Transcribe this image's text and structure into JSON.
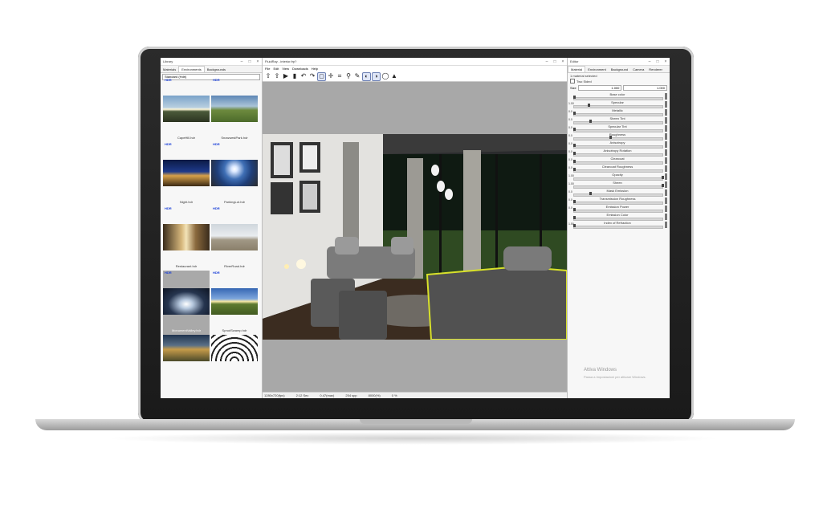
{
  "library": {
    "title": "Library",
    "tabs": [
      "Materials",
      "Environments",
      "Backgrounds"
    ],
    "filter": "Standard (Hdri)",
    "items": [
      {
        "tag": "HDR",
        "name": "CapeHill.hdr"
      },
      {
        "tag": "HDR",
        "name": "SnowwestPark.hdr"
      },
      {
        "tag": "HDR",
        "name": "Night.hdr"
      },
      {
        "tag": "HDR",
        "name": "ParkingLot.hdr"
      },
      {
        "tag": "HDR",
        "name": "Restaurant.hdr"
      },
      {
        "tag": "HDR",
        "name": "RiverRoad.hdr"
      },
      {
        "tag": "HDR",
        "name": "MonumentValley.hdr"
      },
      {
        "tag": "HDR",
        "name": "SprudSwamp.hdr"
      },
      {
        "tag": "",
        "name": ""
      },
      {
        "tag": "",
        "name": ""
      }
    ]
  },
  "viewport": {
    "title": "FluidRay - interior.frp?",
    "menu": [
      "File",
      "Edit",
      "View",
      "Downloads",
      "Help"
    ],
    "status": [
      "1280x720(fps)",
      "2:12 Sec",
      "0.47(max)",
      "254 spp",
      "8000(%)",
      "0 %"
    ]
  },
  "editor": {
    "title": "Editor",
    "tabs": [
      "Material",
      "Environment",
      "Background",
      "Camera",
      "Renderer"
    ],
    "selected": "1 material selected",
    "two_sided": "Two Sided",
    "size_label": "Size",
    "size_x": "1.000",
    "size_y": "1.000",
    "sliders": [
      {
        "label": "Base color",
        "value": ""
      },
      {
        "label": "Specular",
        "value": "1.00"
      },
      {
        "label": "Metallic",
        "value": "0.0"
      },
      {
        "label": "Sheen Tint",
        "value": "0.0"
      },
      {
        "label": "Specular Tint",
        "value": "0.0"
      },
      {
        "label": "Roughness",
        "value": "0.0"
      },
      {
        "label": "Anisotropy",
        "value": "0.0"
      },
      {
        "label": "Anisotropy Rotation",
        "value": "0.0"
      },
      {
        "label": "Clearcoat",
        "value": "0.0"
      },
      {
        "label": "Clearcoat Roughness",
        "value": "0.0"
      },
      {
        "label": "Opacity",
        "value": "1.00"
      },
      {
        "label": "Sheen",
        "value": "1.00"
      },
      {
        "label": "Mask Emission",
        "value": "0.0"
      },
      {
        "label": "Transmission Roughness",
        "value": "0.0"
      },
      {
        "label": "Emission Power",
        "value": "0.0"
      },
      {
        "label": "Emission Color",
        "value": ""
      },
      {
        "label": "Index of Refraction",
        "value": "1.50"
      }
    ],
    "watermark_title": "Attiva Windows",
    "watermark_sub": "Passa a Impostazioni per attivare Windows."
  }
}
